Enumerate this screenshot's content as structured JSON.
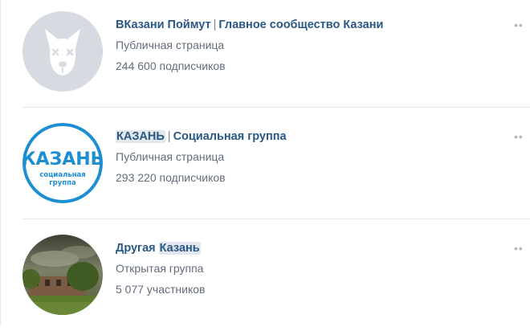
{
  "groups": [
    {
      "name_a": "ВКазани Поймут",
      "separator": "|",
      "name_b": "Главное сообщество Казани",
      "type": "Публичная страница",
      "members": "244 600 подписчиков",
      "avatar_icon": "vk-deactivated-dog-icon"
    },
    {
      "name_a": "КАЗАНЬ",
      "separator": "|",
      "name_b": "Социальная группа",
      "type": "Публичная страница",
      "members": "293 220 подписчиков",
      "logo_text": "КАЗАНЬ",
      "logo_sub1": "социальная",
      "logo_sub2": "группа"
    },
    {
      "name_a": "Другая",
      "name_b": "Казань",
      "type": "Открытая группа",
      "members": "5 077 участников",
      "avatar_icon": "landscape-photo-icon"
    }
  ],
  "more_glyph": "••",
  "colors": {
    "link": "#2a5885",
    "secondary": "#626d7a",
    "divider": "#e7e8ec",
    "kazan_blue": "#1b8fd2"
  }
}
